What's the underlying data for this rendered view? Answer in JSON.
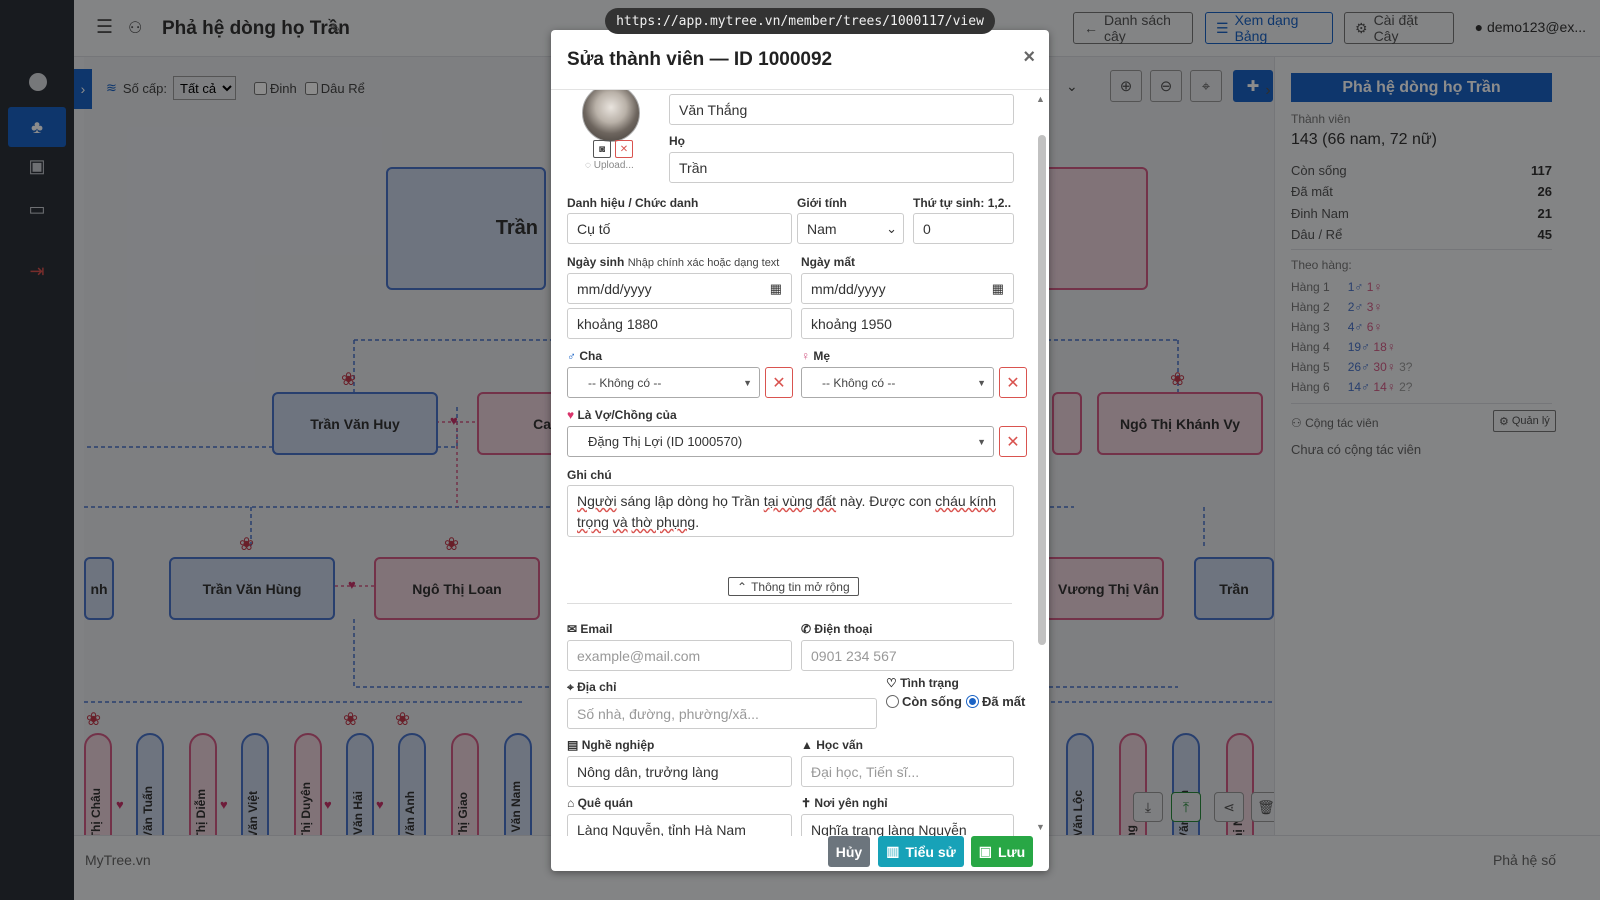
{
  "app": {
    "brand": "MyTree.vn",
    "footer_right": "Phả hệ số",
    "url": "https://app.mytree.vn/member/trees/1000117/view"
  },
  "topbar": {
    "title": "Phả hệ dòng họ Trần",
    "btn_list": "Danh sách cây",
    "btn_table": "Xem dạng Bảng",
    "btn_settings": "Cài đặt Cây",
    "user": "demo123@ex..."
  },
  "toolbar": {
    "gen_label": "Số cấp:",
    "gen_value": "Tất cả",
    "chk_dinh": "Đinh",
    "chk_dau": "Dâu Rể"
  },
  "tree": {
    "top_partial": "Trần",
    "row2": [
      "Trần Văn Huy",
      "Ca",
      "Ngô Thị Khánh Vy"
    ],
    "row3": [
      "nh",
      "Trần Văn Hùng",
      "Ngô Thị Loan",
      "Vương Thị Vân",
      "Trần"
    ],
    "row4": [
      "ao Thị Châu",
      "gô Văn Tuấn",
      "ao Thị Diễm",
      "Vũ Văn Việt",
      "ao Thị Duyên",
      "rần Văn Hải",
      "ần Văn Anh",
      "ao Thị Giao",
      "ăng Văn Nam",
      "am Văn Lộc",
      "ương",
      "ần Văn Lâm",
      "y Thị Nhàn"
    ]
  },
  "right_panel": {
    "title": "Phả hệ dòng họ Trần",
    "members_label": "Thành viên",
    "members_value": "143 (66 nam, 72 nữ)",
    "stats": [
      {
        "label": "Còn sống",
        "value": "117"
      },
      {
        "label": "Đã mất",
        "value": "26"
      },
      {
        "label": "Đinh Nam",
        "value": "21"
      },
      {
        "label": "Dâu / Rể",
        "value": "45"
      }
    ],
    "gen_title": "Theo hàng:",
    "generations": [
      {
        "label": "Hàng 1",
        "male": "1♂",
        "female": "1♀",
        "unknown": ""
      },
      {
        "label": "Hàng 2",
        "male": "2♂",
        "female": "3♀",
        "unknown": ""
      },
      {
        "label": "Hàng 3",
        "male": "4♂",
        "female": "6♀",
        "unknown": ""
      },
      {
        "label": "Hàng 4",
        "male": "19♂",
        "female": "18♀",
        "unknown": ""
      },
      {
        "label": "Hàng 5",
        "male": "26♂",
        "female": "30♀",
        "unknown": "3?"
      },
      {
        "label": "Hàng 6",
        "male": "14♂",
        "female": "14♀",
        "unknown": "2?"
      }
    ],
    "collab_label": "Cộng tác viên",
    "manage_btn": "Quản lý",
    "collab_empty": "Chưa có cộng tác viên"
  },
  "modal": {
    "title": "Sửa thành viên — ID 1000092",
    "upload": "Upload...",
    "given_name": "Văn Thắng",
    "surname_label": "Họ",
    "surname": "Trần",
    "title_label": "Danh hiệu / Chức danh",
    "title_value": "Cụ tố",
    "gender_label": "Giới tính",
    "gender_value": "Nam",
    "birth_order_label": "Thứ tự sinh: 1,2..",
    "birth_order_value": "0",
    "dob_label": "Ngày sinh",
    "dob_hint": "Nhập chính xác hoặc dạng text",
    "dod_label": "Ngày mất",
    "date_placeholder": "mm/dd/yyyy",
    "dob_text": "khoảng 1880",
    "dod_text": "khoảng 1950",
    "father_label": "Cha",
    "mother_label": "Mẹ",
    "none_option": "-- Không có --",
    "spouse_label": "Là Vợ/Chồng của",
    "spouse_value": "Đặng Thị Lợi (ID 1000570)",
    "note_label": "Ghi chú",
    "note_line1_a": "Người",
    "note_line1_b": "sáng lập dòng",
    "note_line1_c": "họ Trần",
    "note_line1_d": "tại vùng đất",
    "note_line1_e": "này. Được con",
    "note_line1_f": "cháu kính",
    "note_line2_a": "trọng",
    "note_line2_b": "và",
    "note_line2_c": "thờ phụng",
    "note_line2_d": ".",
    "more_btn": "Thông tin mở rộng",
    "email_label": "Email",
    "email_placeholder": "example@mail.com",
    "phone_label": "Điện thoại",
    "phone_placeholder": "0901 234 567",
    "address_label": "Địa chỉ",
    "address_placeholder": "Số nhà, đường, phường/xã...",
    "status_label": "Tình trạng",
    "status_alive": "Còn sống",
    "status_dead": "Đã mất",
    "job_label": "Nghề nghiệp",
    "job_value": "Nông dân, trưởng làng",
    "edu_label": "Học vấn",
    "edu_placeholder": "Đại học, Tiến sĩ...",
    "hometown_label": "Quê quán",
    "hometown_value": "Làng Nguyễn, tỉnh Hà Nam",
    "rest_label": "Nơi yên nghỉ",
    "rest_value": "Nghĩa trang làng Nguyễn",
    "btn_cancel": "Hủy",
    "btn_bio": "Tiểu sử",
    "btn_save": "Lưu"
  }
}
